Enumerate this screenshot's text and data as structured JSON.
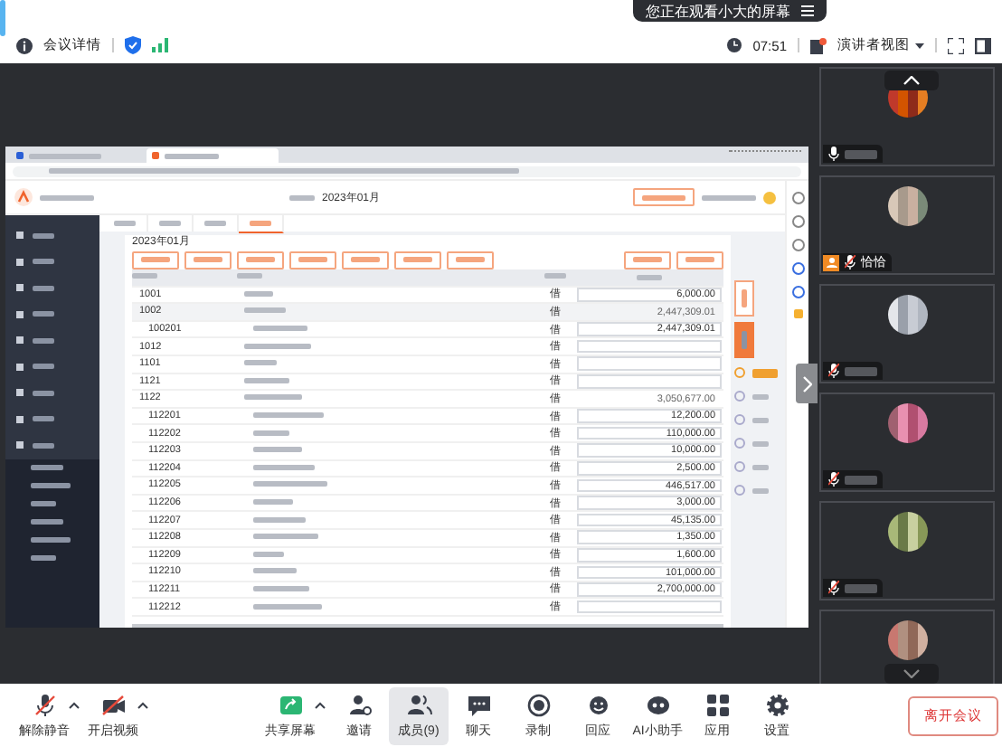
{
  "top": {
    "banner": "您正在观看小大的屏幕",
    "meeting_details": "会议详情",
    "time": "07:51",
    "view_mode": "演讲者视图"
  },
  "shared_screen": {
    "header_period": "2023年01月",
    "period": "2023年01月",
    "rows": [
      {
        "code": "1001",
        "direction": "借",
        "amount": "6,000.00",
        "editable": true,
        "highlighted": false
      },
      {
        "code": "1002",
        "direction": "借",
        "amount": "2,447,309.01",
        "editable": false,
        "highlighted": true,
        "children": [
          {
            "code": "100201",
            "direction": "借",
            "amount": "2,447,309.01",
            "editable": true,
            "highlighted": false
          }
        ]
      },
      {
        "code": "1012",
        "direction": "借",
        "editable": true,
        "highlighted": false
      },
      {
        "code": "1101",
        "direction": "借",
        "editable": true,
        "highlighted": false
      },
      {
        "code": "1121",
        "direction": "借",
        "editable": true,
        "highlighted": false
      },
      {
        "code": "1122",
        "direction": "借",
        "amount": "3,050,677.00",
        "editable": false,
        "highlighted": false,
        "children": [
          {
            "code": "112201",
            "direction": "借",
            "amount": "12,200.00",
            "editable": true,
            "highlighted": false
          },
          {
            "code": "112202",
            "direction": "借",
            "amount": "110,000.00",
            "editable": true,
            "highlighted": false
          },
          {
            "code": "112203",
            "direction": "借",
            "amount": "10,000.00",
            "editable": true,
            "highlighted": false
          },
          {
            "code": "112204",
            "direction": "借",
            "amount": "2,500.00",
            "editable": true,
            "highlighted": false
          },
          {
            "code": "112205",
            "direction": "借",
            "amount": "446,517.00",
            "editable": true,
            "highlighted": false
          },
          {
            "code": "112206",
            "direction": "借",
            "amount": "3,000.00",
            "editable": true,
            "highlighted": false
          },
          {
            "code": "112207",
            "direction": "借",
            "amount": "45,135.00",
            "editable": true,
            "highlighted": false
          },
          {
            "code": "112208",
            "direction": "借",
            "amount": "1,350.00",
            "editable": true,
            "highlighted": false
          },
          {
            "code": "112209",
            "direction": "借",
            "amount": "1,600.00",
            "editable": true,
            "highlighted": false
          },
          {
            "code": "112210",
            "direction": "借",
            "amount": "101,000.00",
            "editable": true,
            "highlighted": false
          },
          {
            "code": "112211",
            "direction": "借",
            "amount": "2,700,000.00",
            "editable": true,
            "highlighted": false
          },
          {
            "code": "112212",
            "direction": "借",
            "editable": true,
            "highlighted": false
          }
        ]
      }
    ]
  },
  "participants": [
    {
      "muted": false,
      "host": false
    },
    {
      "name": "恰恰",
      "muted": true,
      "host": true
    },
    {
      "muted": true,
      "host": false
    },
    {
      "muted": true,
      "host": false
    },
    {
      "muted": true,
      "host": false
    },
    {
      "host": false
    }
  ],
  "toolbar": {
    "items": [
      {
        "kind": "mic",
        "label": "解除静音",
        "caret": true,
        "selected": false
      },
      {
        "kind": "camera",
        "label": "开启视频",
        "caret": true,
        "selected": false
      },
      {
        "kind": "share",
        "label": "共享屏幕",
        "caret": true,
        "selected": false
      },
      {
        "kind": "invite",
        "label": "邀请",
        "caret": false,
        "selected": false
      },
      {
        "kind": "members",
        "label": "成员(9)",
        "caret": false,
        "selected": true
      },
      {
        "kind": "chat",
        "label": "聊天",
        "caret": false,
        "selected": false
      },
      {
        "kind": "record",
        "label": "录制",
        "caret": false,
        "selected": false
      },
      {
        "kind": "react",
        "label": "回应",
        "caret": false,
        "selected": false
      },
      {
        "kind": "ai",
        "label": "AI小助手",
        "caret": false,
        "selected": false
      },
      {
        "kind": "apps",
        "label": "应用",
        "caret": false,
        "selected": false
      },
      {
        "kind": "settings",
        "label": "设置",
        "caret": false,
        "selected": false
      }
    ],
    "leave": "离开会议"
  }
}
